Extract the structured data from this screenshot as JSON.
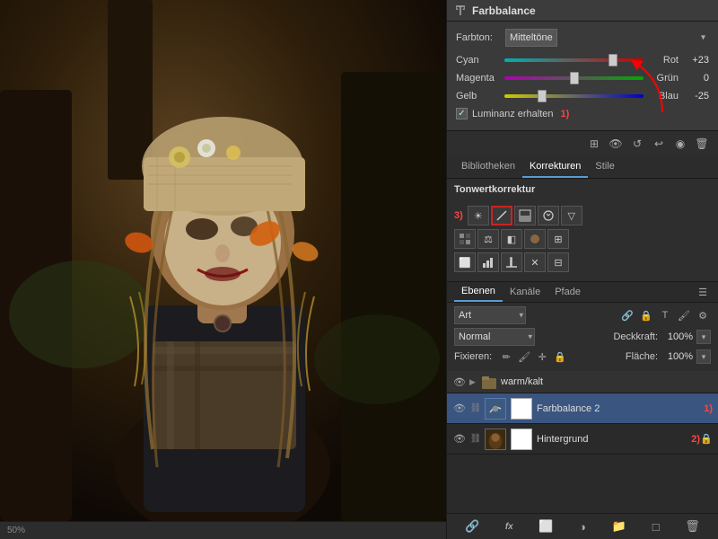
{
  "farbbalance": {
    "title": "Farbbalance",
    "farbton_label": "Farbton:",
    "farbton_value": "Mitteltöne",
    "sliders": [
      {
        "left": "Cyan",
        "right": "Rot",
        "value": "+23",
        "position": 0.78
      },
      {
        "left": "Magenta",
        "right": "Grün",
        "value": "0",
        "position": 0.5
      },
      {
        "left": "Gelb",
        "right": "Blau",
        "value": "-25",
        "position": 0.27
      }
    ],
    "luminanz_label": "Luminanz erhalten",
    "luminanz_checked": true,
    "annotation1": "1)"
  },
  "tabs": {
    "items": [
      {
        "label": "Bibliotheken",
        "active": false
      },
      {
        "label": "Korrekturen",
        "active": true
      },
      {
        "label": "Stile",
        "active": false
      }
    ]
  },
  "korrekturen": {
    "title": "Tonwertkorrektur",
    "annotation3": "3)",
    "icons_row1": [
      {
        "name": "brightness-icon",
        "symbol": "☀",
        "highlighted": false
      },
      {
        "name": "curves-icon",
        "symbol": "↗",
        "highlighted": true
      },
      {
        "name": "exposure-icon",
        "symbol": "⬛",
        "highlighted": false
      },
      {
        "name": "vibrance-icon",
        "symbol": "◈",
        "highlighted": false
      },
      {
        "name": "triangle-icon",
        "symbol": "▽",
        "highlighted": false
      }
    ],
    "icons_row2": [
      {
        "name": "hsl-icon",
        "symbol": "▦",
        "highlighted": false
      },
      {
        "name": "colorbal-icon",
        "symbol": "⚖",
        "highlighted": false
      },
      {
        "name": "bw-icon",
        "symbol": "◧",
        "highlighted": false
      },
      {
        "name": "photo-icon",
        "symbol": "◆",
        "highlighted": false
      },
      {
        "name": "gradient-icon",
        "symbol": "⊞",
        "highlighted": false
      }
    ],
    "icons_row3": [
      {
        "name": "invert-icon",
        "symbol": "⬜",
        "highlighted": false
      },
      {
        "name": "posterize-icon",
        "symbol": "⬛",
        "highlighted": false
      },
      {
        "name": "threshold-icon",
        "symbol": "⬛",
        "highlighted": false
      },
      {
        "name": "selective-icon",
        "symbol": "✕",
        "highlighted": false
      },
      {
        "name": "channel-icon",
        "symbol": "⊟",
        "highlighted": false
      }
    ]
  },
  "ebenen": {
    "tabs": [
      {
        "label": "Ebenen",
        "active": true
      },
      {
        "label": "Kanäle",
        "active": false
      },
      {
        "label": "Pfade",
        "active": false
      }
    ],
    "art_label": "Art",
    "blend_mode": "Normal",
    "deckkraft_label": "Deckkraft:",
    "deckkraft_value": "100%",
    "fixieren_label": "Fixieren:",
    "flaeche_label": "Fläche:",
    "flaeche_value": "100%",
    "layers": [
      {
        "name": "warm/kalt",
        "type": "group",
        "visible": true,
        "expanded": true
      },
      {
        "name": "Farbbalance 2",
        "type": "adjustment",
        "visible": true,
        "selected": true,
        "badge": "1)"
      },
      {
        "name": "Hintergrund",
        "type": "image",
        "visible": true,
        "selected": false,
        "badge": "2)",
        "locked": true
      }
    ]
  },
  "bottom_toolbar": {
    "icons": [
      {
        "name": "link-icon",
        "symbol": "🔗"
      },
      {
        "name": "fx-icon",
        "symbol": "fx"
      },
      {
        "name": "mask-icon",
        "symbol": "⬜"
      },
      {
        "name": "adjustment-icon",
        "symbol": "◑"
      },
      {
        "name": "group-icon",
        "symbol": "📁"
      },
      {
        "name": "new-layer-icon",
        "symbol": "□"
      },
      {
        "name": "delete-icon",
        "symbol": "🗑"
      }
    ]
  }
}
